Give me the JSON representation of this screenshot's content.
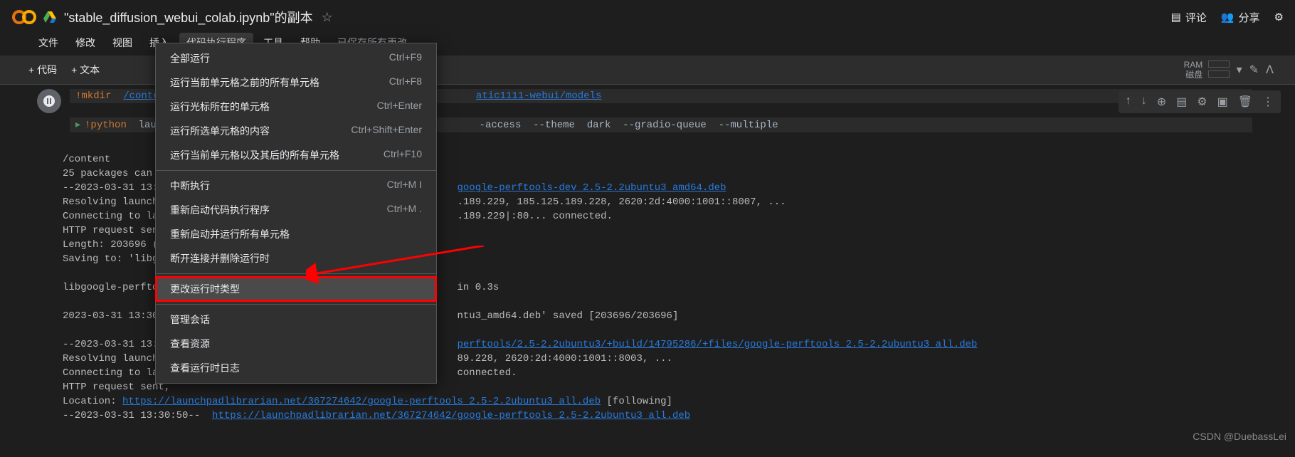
{
  "header": {
    "title": "\"stable_diffusion_webui_colab.ipynb\"的副本",
    "comment": "评论",
    "share": "分享"
  },
  "menubar": {
    "items": [
      "文件",
      "修改",
      "视图",
      "插入",
      "代码执行程序",
      "工具",
      "帮助"
    ],
    "saved": "已保存所有更改"
  },
  "toolbar": {
    "code": "+ 代码",
    "text": "+ 文本",
    "ram": "RAM",
    "disk": "磁盘"
  },
  "dropdown": [
    {
      "label": "全部运行",
      "shortcut": "Ctrl+F9"
    },
    {
      "label": "运行当前单元格之前的所有单元格",
      "shortcut": "Ctrl+F8"
    },
    {
      "label": "运行光标所在的单元格",
      "shortcut": "Ctrl+Enter"
    },
    {
      "label": "运行所选单元格的内容",
      "shortcut": "Ctrl+Shift+Enter"
    },
    {
      "label": "运行当前单元格以及其后的所有单元格",
      "shortcut": "Ctrl+F10"
    },
    {
      "sep": true
    },
    {
      "label": "中断执行",
      "shortcut": "Ctrl+M I"
    },
    {
      "label": "重新启动代码执行程序",
      "shortcut": "Ctrl+M ."
    },
    {
      "label": "重新启动并运行所有单元格",
      "shortcut": ""
    },
    {
      "label": "断开连接并删除运行时",
      "shortcut": ""
    },
    {
      "sep": true
    },
    {
      "label": "更改运行时类型",
      "shortcut": "",
      "boxed": true,
      "hl": true
    },
    {
      "sep": true
    },
    {
      "label": "管理会话",
      "shortcut": ""
    },
    {
      "label": "查看资源",
      "shortcut": ""
    },
    {
      "label": "查看运行时日志",
      "shortcut": ""
    }
  ],
  "code": {
    "line1_cmd": "!mkdir",
    "line1_path": "/content/s",
    "line1_rest": "atic1111-webui/models",
    "line2_cmd": "!python",
    "line2_file": "launch.py",
    "line2_rest": "-access  --theme  dark  --gradio-queue  --multiple"
  },
  "output": {
    "l1": "/content",
    "l2": "25 packages can be",
    "l3": "--2023-03-31 13:30",
    "l3b": "google-perftools-dev 2.5-2.2ubuntu3 amd64.deb",
    "l4a": "Resolving launchpa",
    "l4b": ".189.229, 185.125.189.228, 2620:2d:4000:1001::8007, ...",
    "l5a": "Connecting to laun",
    "l5b": ".189.229|:80... connected.",
    "l6": "HTTP request sent,",
    "l7": "Length: 203696 (19",
    "l8": "Saving to: 'libgo",
    "l9": "libgoogle-perftoo",
    "l9b": "in 0.3s",
    "l10": "2023-03-31 13:30:4",
    "l10b": "ntu3_amd64.deb' saved [203696/203696]",
    "l11": "--2023-03-31 13:30",
    "l11b": "perftools/2.5-2.2ubuntu3/+build/14795286/+files/google-perftools 2.5-2.2ubuntu3 all.deb",
    "l12a": "Resolving launchpa",
    "l12b": "89.228, 2620:2d:4000:1001::8003, ...",
    "l13a": "Connecting to laun",
    "l13b": "connected.",
    "l14": "HTTP request sent,",
    "l15a": "Location: ",
    "l15b": "https://launchpadlibrarian.net/367274642/google-perftools 2.5-2.2ubuntu3 all.deb",
    "l15c": " [following]",
    "l16a": "--2023-03-31 13:30:50--  ",
    "l16b": "https://launchpadlibrarian.net/367274642/google-perftools 2.5-2.2ubuntu3 all.deb"
  },
  "watermark": "CSDN @DuebassLei"
}
